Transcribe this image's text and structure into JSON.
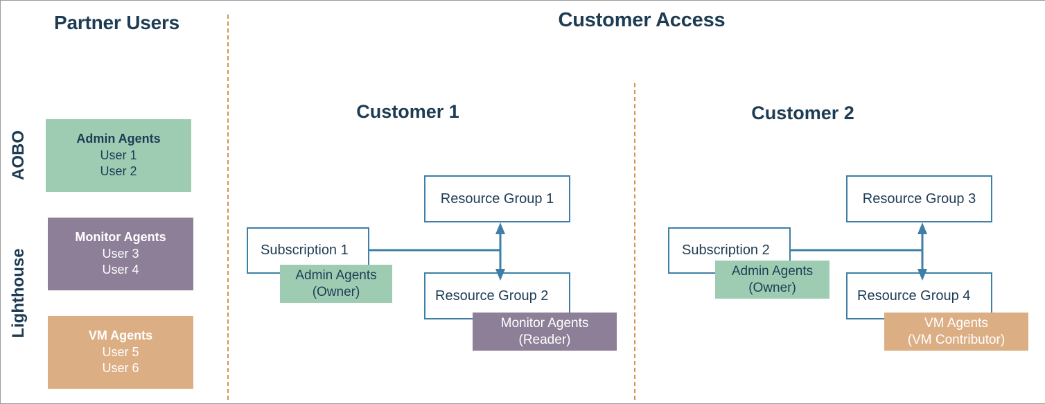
{
  "headings": {
    "partner_users": "Partner Users",
    "customer_access": "Customer Access"
  },
  "rails": [
    {
      "id": "aobo",
      "label": "AOBO"
    },
    {
      "id": "lighthouse",
      "label": "Lighthouse"
    }
  ],
  "partner_groups": [
    {
      "id": "admin-agents",
      "title": "Admin Agents",
      "users": [
        "User 1",
        "User 2"
      ],
      "color": "#9ECCB3",
      "rail": "AOBO"
    },
    {
      "id": "monitor-agents",
      "title": "Monitor Agents",
      "users": [
        "User 3",
        "User 4"
      ],
      "color": "#8C7F97",
      "rail": "Lighthouse"
    },
    {
      "id": "vm-agents",
      "title": "VM Agents",
      "users": [
        "User 5",
        "User 6"
      ],
      "color": "#DCAE84",
      "rail": "Lighthouse"
    }
  ],
  "customers": [
    {
      "id": "customer-1",
      "title": "Customer 1",
      "subscription": {
        "label": "Subscription 1",
        "role_chip": {
          "agent": "Admin Agents",
          "role": "(Owner)",
          "color": "#9ECCB3"
        }
      },
      "resource_groups": [
        {
          "label": "Resource Group 1",
          "role_chip": null
        },
        {
          "label": "Resource Group 2",
          "role_chip": {
            "agent": "Monitor Agents",
            "role": "(Reader)",
            "color": "#8C7F97"
          }
        }
      ]
    },
    {
      "id": "customer-2",
      "title": "Customer 2",
      "subscription": {
        "label": "Subscription 2",
        "role_chip": {
          "agent": "Admin Agents",
          "role": "(Owner)",
          "color": "#9ECCB3"
        }
      },
      "resource_groups": [
        {
          "label": "Resource Group 3",
          "role_chip": null
        },
        {
          "label": "Resource Group 4",
          "role_chip": {
            "agent": "VM Agents",
            "role": "(VM Contributor)",
            "color": "#DCAE84"
          }
        }
      ]
    }
  ],
  "colors": {
    "heading_text": "#1d3c53",
    "box_border": "#3D7FA6",
    "connector": "#3D7FA6",
    "divider": "#d4954a",
    "green": "#9ECCB3",
    "purple": "#8C7F97",
    "orange": "#DCAE84",
    "background": "#ffffff"
  }
}
